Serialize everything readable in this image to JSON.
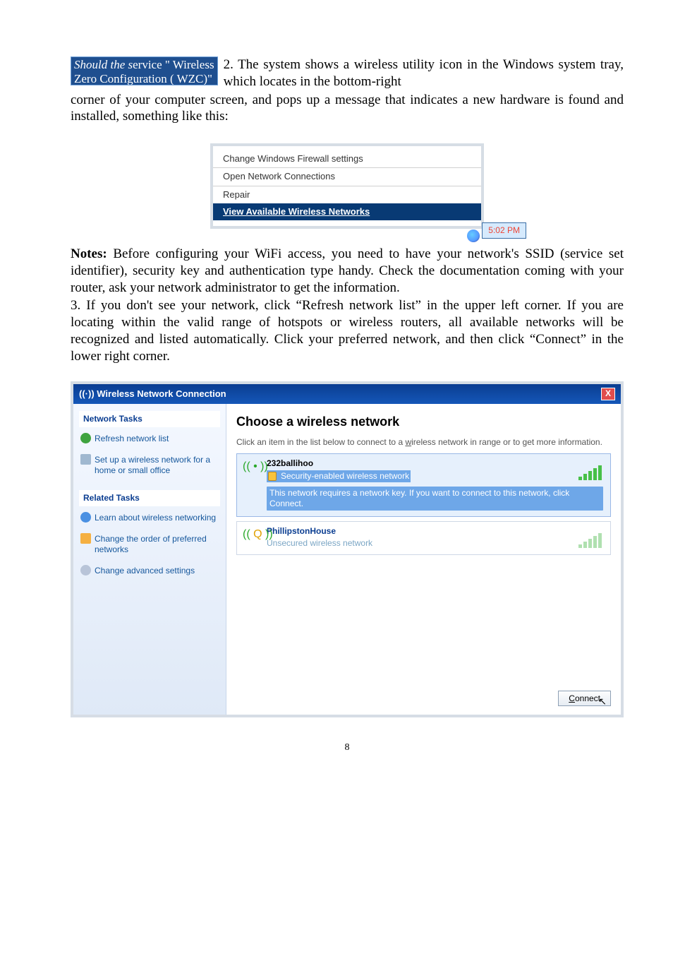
{
  "callout": {
    "line1_italic": "Should the s",
    "line1_reg": "ervice \" Wireless",
    "line2": "Zero Configuration ( WZC)\""
  },
  "p1_a": "2.  The  system  shows  a  wireless  utility  icon  in  the Windows system tray, which locates in the bottom-right",
  "p1_b": "corner of your computer screen, and pops up a message that indicates a new hardware is found and installed, something like this:",
  "menu": {
    "item1": "Change Windows Firewall settings",
    "item2": "Open Network Connections",
    "item3": "Repair",
    "item4": "View Available Wireless Networks",
    "time": "5:02 PM"
  },
  "notes_label": "Notes:",
  "notes_text": " Before configuring your WiFi access, you need to have your network's SSID (service set identifier), security key and authentication type handy. Check the documentation coming with your router, ask your network administrator to get the information.",
  "p3": "3. If you don't see your network, click “Refresh network list” in the upper left corner. If you are locating within the valid range of hotspots or wireless routers, all available networks will be recognized and listed automatically. Click your preferred network, and then click “Connect” in the lower right corner.",
  "wnc": {
    "title": "((·)) Wireless Network Connection",
    "side": {
      "sec1": "Network Tasks",
      "refresh": "Refresh network list",
      "setup": "Set up a wireless network for a home or small office",
      "sec2": "Related Tasks",
      "learn": "Learn about wireless networking",
      "order": "Change the order of preferred networks",
      "adv": "Change advanced settings"
    },
    "main": {
      "heading": "Choose a wireless network",
      "desc_a": "Click an item in the list below to connect to a ",
      "desc_u": "w",
      "desc_b": "ireless network in range or to get more information.",
      "net1": {
        "name": "232ballihoo",
        "sec": "Security-enabled wireless network",
        "hint": "This network requires a network key. If you want to connect to this network, click Connect."
      },
      "net2": {
        "name": "PhillipstonHouse",
        "sec": "Unsecured wireless network"
      },
      "connect": "Connect"
    }
  },
  "page_number": "8"
}
